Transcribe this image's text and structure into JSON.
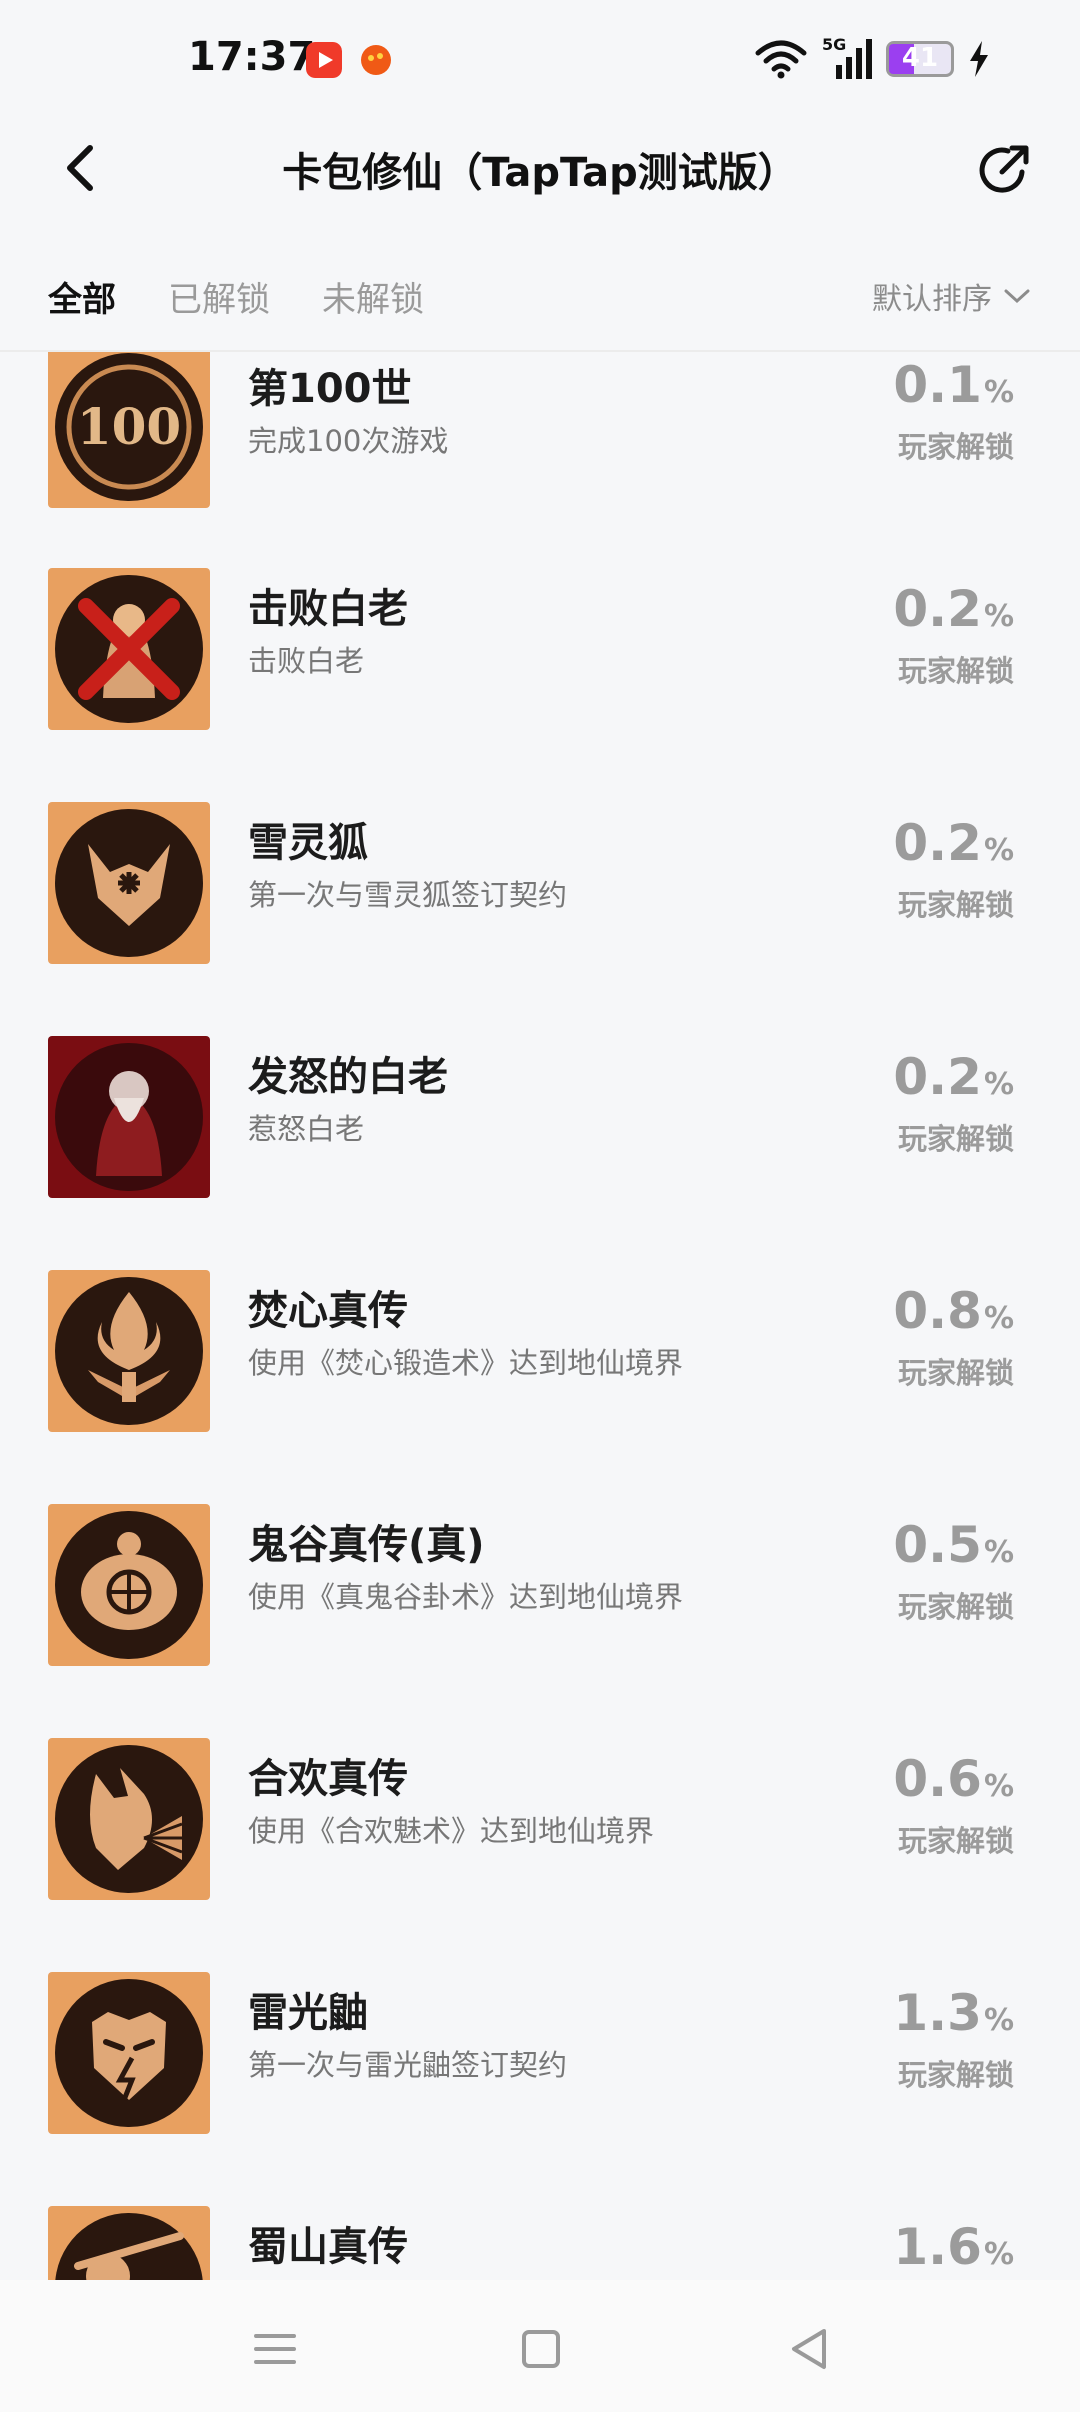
{
  "status": {
    "time": "17:37",
    "battery": "41",
    "network": "5G",
    "battery_level": 41,
    "icons": [
      "video-app-icon",
      "chat-app-icon",
      "wifi-icon",
      "cell-signal-icon",
      "charging-icon"
    ]
  },
  "header": {
    "title": "卡包修仙（TapTap测试版）",
    "back_icon": "back-chevron-icon",
    "share_icon": "share-icon"
  },
  "tabs": [
    {
      "label": "全部",
      "active": true
    },
    {
      "label": "已解锁",
      "active": false
    },
    {
      "label": "未解锁",
      "active": false
    }
  ],
  "sort": {
    "label": "默认排序"
  },
  "common": {
    "unlock_label": "玩家解锁",
    "percent_sign": "%"
  },
  "achievements": [
    {
      "name": "第100世",
      "desc": "完成100次游戏",
      "pct": "0.1",
      "icon": "100-lives-badge-icon"
    },
    {
      "name": "击败白老",
      "desc": "击败白老",
      "pct": "0.2",
      "icon": "defeat-elder-badge-icon"
    },
    {
      "name": "雪灵狐",
      "desc": "第一次与雪灵狐签订契约",
      "pct": "0.2",
      "icon": "snow-fox-badge-icon"
    },
    {
      "name": "发怒的白老",
      "desc": "惹怒白老",
      "pct": "0.2",
      "icon": "angry-elder-badge-icon"
    },
    {
      "name": "焚心真传",
      "desc": "使用《焚心锻造术》达到地仙境界",
      "pct": "0.8",
      "icon": "flame-forge-badge-icon"
    },
    {
      "name": "鬼谷真传(真)",
      "desc": "使用《真鬼谷卦术》达到地仙境界",
      "pct": "0.5",
      "icon": "tortoise-bagua-badge-icon"
    },
    {
      "name": "合欢真传",
      "desc": "使用《合欢魅术》达到地仙境界",
      "pct": "0.6",
      "icon": "fox-fan-badge-icon"
    },
    {
      "name": "雷光鼬",
      "desc": "第一次与雷光鼬签订契约",
      "pct": "1.3",
      "icon": "thunder-weasel-badge-icon"
    },
    {
      "name": "蜀山真传",
      "desc": "",
      "pct": "1.6",
      "icon": "sword-badge-icon"
    }
  ],
  "colors": {
    "badge_gold": "#e8a060",
    "badge_dark": "#2a170e",
    "badge_red": "#7a0d12",
    "accent_purple": "#9b3ff0"
  },
  "navbar": {
    "icons": [
      "menu-icon",
      "home-square-icon",
      "back-triangle-icon"
    ]
  }
}
